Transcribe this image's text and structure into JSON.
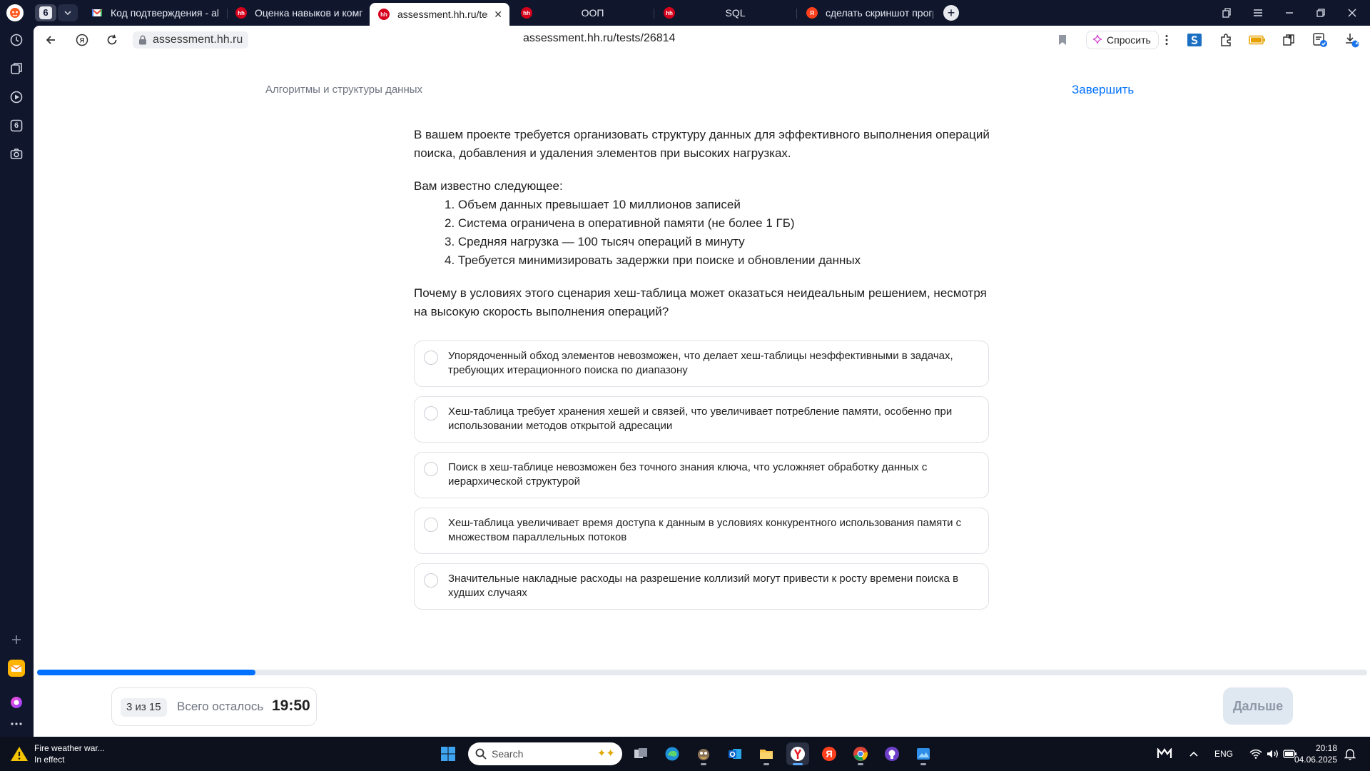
{
  "tabs": {
    "count_badge": "6",
    "items": [
      {
        "label": "Код подтверждения - ale",
        "favicon": "gmail-icon",
        "active": false
      },
      {
        "label": "Оценка навыков и компе",
        "favicon": "hh-icon",
        "active": false
      },
      {
        "label": "assessment.hh.ru/tests/",
        "favicon": "hh-icon",
        "active": true
      },
      {
        "label": "ООП",
        "favicon": "hh-icon",
        "active": false
      },
      {
        "label": "SQL",
        "favicon": "hh-icon",
        "active": false
      },
      {
        "label": "сделать скриншот програ",
        "favicon": "yandex-icon",
        "active": false
      }
    ],
    "favicon_text": "hh",
    "yandex_letter": "Я"
  },
  "toolbar": {
    "domain": "assessment.hh.ru",
    "url": "assessment.hh.ru/tests/26814",
    "ask_label": "Спросить",
    "downloads_badge": "2"
  },
  "sidebar": {
    "tab_counter": "6"
  },
  "page": {
    "breadcrumb": "Алгоритмы и структуры данных",
    "finish_label": "Завершить",
    "question": {
      "intro": "В вашем проекте требуется организовать структуру данных для эффективного выполнения операций поиска, добавления и удаления элементов при высоких нагрузках.",
      "known_title": "Вам известно следующее:",
      "facts": [
        "1. Объем данных превышает 10 миллионов записей",
        "2. Система ограничена в оперативной памяти (не более 1 ГБ)",
        "3. Средняя нагрузка — 100 тысяч операций в минуту",
        "4. Требуется минимизировать задержки при поиске и обновлении данных"
      ],
      "prompt": "Почему в условиях этого сценария хеш-таблица может оказаться неидеальным решением, несмотря на высокую скорость выполнения операций?"
    },
    "options": [
      "Упорядоченный обход элементов невозможен, что делает хеш-таблицы неэффективными в задачах, требующих итерационного поиска по диапазону",
      "Хеш-таблица требует хранения хешей и связей, что увеличивает потребление памяти, особенно при использовании методов открытой адресации",
      "Поиск в хеш-таблице невозможен без точного знания ключа, что усложняет обработку данных с иерархической структурой",
      "Хеш-таблица увеличивает время доступа к данным в условиях конкурентного использования памяти с множеством параллельных потоков",
      "Значительные накладные расходы на разрешение коллизий могут привести к росту времени поиска в худших случаях"
    ],
    "progress": {
      "current": 3,
      "total": 15,
      "fraction": 0.164,
      "counter_label": "3 из 15",
      "remaining_label": "Всего осталось",
      "time_left": "19:50"
    },
    "next_label": "Дальше"
  },
  "taskbar": {
    "weather_title": "Fire weather war...",
    "weather_status": "In effect",
    "search_placeholder": "Search",
    "lang": "ENG",
    "time": "20:18",
    "date": "04.06.2025"
  },
  "colors": {
    "accent": "#0070ff",
    "hh_red": "#d6001c",
    "frame": "#10172d"
  }
}
